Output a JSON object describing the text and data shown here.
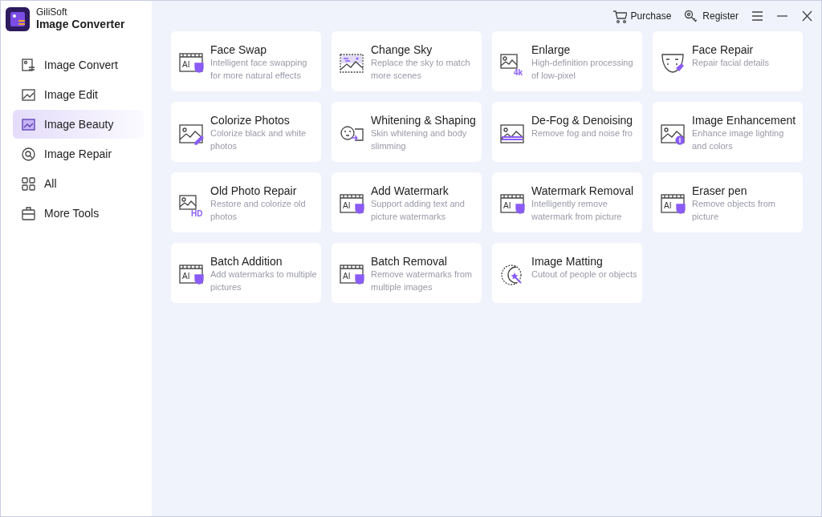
{
  "app": {
    "vendor": "GiliSoft",
    "name": "Image Converter"
  },
  "sidebar": {
    "items": [
      {
        "label": "Image Convert",
        "selected": false
      },
      {
        "label": "Image Edit",
        "selected": false
      },
      {
        "label": "Image Beauty",
        "selected": true
      },
      {
        "label": "Image Repair",
        "selected": false
      },
      {
        "label": "All",
        "selected": false
      },
      {
        "label": "More Tools",
        "selected": false
      }
    ]
  },
  "header": {
    "links": [
      {
        "label": "Purchase"
      },
      {
        "label": "Register"
      }
    ]
  },
  "tools": [
    {
      "title": "Face Swap",
      "description": "Intelligent face swapping for more natural effects",
      "icon_label": "AI"
    },
    {
      "title": "Change Sky",
      "description": "Replace the sky to match more scenes"
    },
    {
      "title": "Enlarge",
      "description": "High-definition processing of low-pixel",
      "icon_label": "4k"
    },
    {
      "title": "Face Repair",
      "description": "Repair facial details"
    },
    {
      "title": "Colorize Photos",
      "description": "Colorize black and white photos"
    },
    {
      "title": "Whitening & Shaping",
      "description": "Skin whitening and body slimming"
    },
    {
      "title": "De-Fog & Denoising",
      "description": "Remove fog and noise fro"
    },
    {
      "title": "Image Enhancement",
      "description": "Enhance image lighting and colors"
    },
    {
      "title": "Old Photo Repair",
      "description": "Restore and colorize old photos",
      "icon_label": "HD"
    },
    {
      "title": "Add Watermark",
      "description": "Support adding text and picture watermarks",
      "icon_label": "AI"
    },
    {
      "title": "Watermark Removal",
      "description": "Intelligently remove watermark from picture",
      "icon_label": "AI"
    },
    {
      "title": "Eraser pen",
      "description": "Remove objects from picture",
      "icon_label": "AI"
    },
    {
      "title": "Batch Addition",
      "description": "Add watermarks to multiple pictures",
      "icon_label": "AI"
    },
    {
      "title": "Batch Removal",
      "description": "Remove watermarks from multiple images",
      "icon_label": "AI"
    },
    {
      "title": "Image Matting",
      "description": "Cutout of people or objects"
    }
  ]
}
